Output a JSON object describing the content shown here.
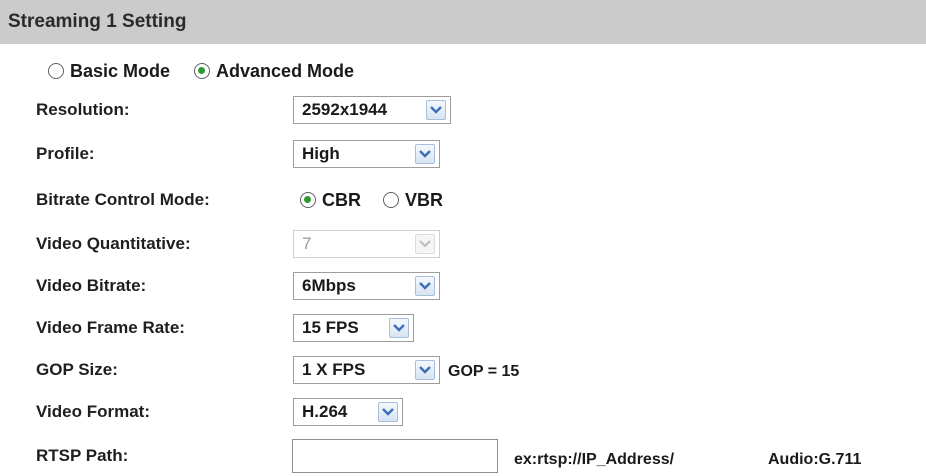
{
  "header": {
    "title": "Streaming 1 Setting"
  },
  "mode": {
    "basic_label": "Basic Mode",
    "advanced_label": "Advanced Mode",
    "selected": "Advanced Mode"
  },
  "fields": {
    "resolution": {
      "label": "Resolution:",
      "value": "2592x1944"
    },
    "profile": {
      "label": "Profile:",
      "value": "High"
    },
    "bitrate_control": {
      "label": "Bitrate Control Mode:",
      "cbr_label": "CBR",
      "vbr_label": "VBR",
      "selected": "CBR"
    },
    "video_quantitative": {
      "label": "Video Quantitative:",
      "value": "7",
      "disabled": true
    },
    "video_bitrate": {
      "label": "Video Bitrate:",
      "value": "6Mbps"
    },
    "video_frame_rate": {
      "label": "Video Frame Rate:",
      "value": "15 FPS"
    },
    "gop_size": {
      "label": "GOP Size:",
      "value": "1 X FPS",
      "gop_text": "GOP = 15"
    },
    "video_format": {
      "label": "Video Format:",
      "value": "H.264"
    },
    "rtsp_path": {
      "label": "RTSP Path:",
      "value": "",
      "example": "ex:rtsp://IP_Address/",
      "audio": "Audio:G.711"
    }
  },
  "colors": {
    "header_bg": "#cbcbcb",
    "radio_selected": "#2f9a2f",
    "dropdown_arrow": "#3d6fb6"
  },
  "icons": {
    "dropdown": "chevron-down-icon",
    "radio_checked": "radio-checked-icon",
    "radio_unchecked": "radio-unchecked-icon"
  }
}
